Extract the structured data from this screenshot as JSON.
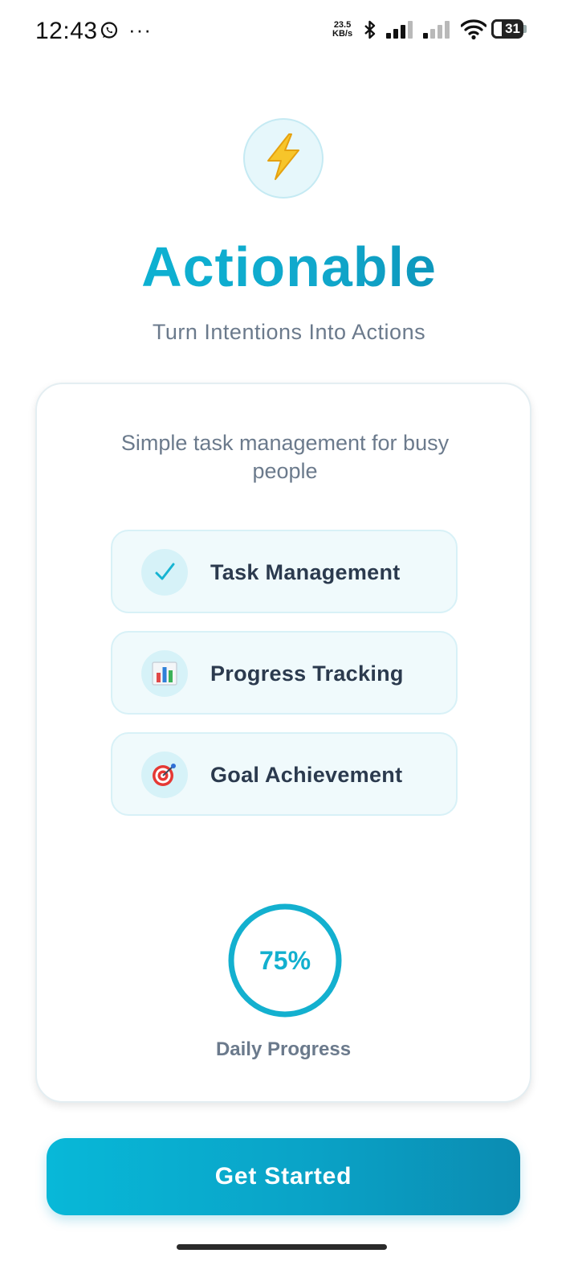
{
  "status_bar": {
    "time": "12:43",
    "more": "···",
    "speed_value": "23.5",
    "speed_unit": "KB/s",
    "battery": "31",
    "icons": [
      "whatsapp-icon",
      "bluetooth-icon",
      "signal-icon",
      "signal-icon",
      "wifi-icon",
      "battery-icon"
    ]
  },
  "app": {
    "logo_icon": "lightning-bolt-icon",
    "title": "Actionable",
    "tagline": "Turn Intentions Into Actions"
  },
  "card": {
    "subtitle": "Simple task management for busy people",
    "features": [
      {
        "label": "Task Management",
        "icon": "checkmark-icon"
      },
      {
        "label": "Progress Tracking",
        "icon": "bar-chart-icon"
      },
      {
        "label": "Goal Achievement",
        "icon": "target-icon"
      }
    ],
    "progress": {
      "value_text": "75%",
      "label": "Daily Progress"
    }
  },
  "cta": {
    "label": "Get Started"
  },
  "colors": {
    "accent": "#0bb8d6",
    "accent_dark": "#0b82a8",
    "text_dark": "#2b3a4e",
    "text_muted": "#6b7a8c",
    "feature_bg": "#f0fafc"
  }
}
